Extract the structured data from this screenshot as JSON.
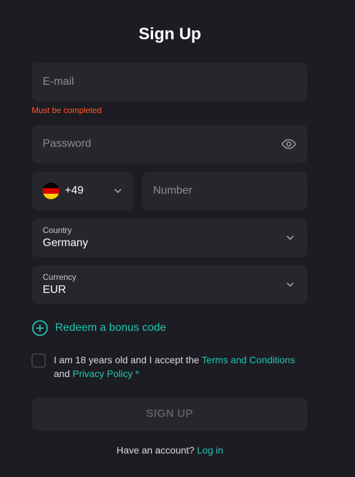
{
  "header": {
    "title": "Sign Up"
  },
  "form": {
    "email": {
      "placeholder": "E-mail",
      "error": "Must be completed"
    },
    "password": {
      "placeholder": "Password",
      "toggle_icon": "eye-icon"
    },
    "phone": {
      "country_code": "+49",
      "flag": "germany-flag-icon",
      "number_placeholder": "Number"
    },
    "country": {
      "label": "Country",
      "value": "Germany"
    },
    "currency": {
      "label": "Currency",
      "value": "EUR"
    },
    "bonus": {
      "label": "Redeem a bonus code",
      "icon": "plus-circle-icon"
    },
    "consent": {
      "prefix": "I am 18 years old and I accept the ",
      "terms_link": "Terms and Conditions",
      "and_text": "and",
      "privacy_link": "Privacy Policy",
      "required_mark": "*"
    },
    "submit_label": "SIGN UP"
  },
  "footer": {
    "question": "Have an account?",
    "login_link": "Log in"
  },
  "colors": {
    "background": "#1c1c22",
    "field": "#26262d",
    "accent": "#1fc7b6",
    "error": "#ff5a2d"
  }
}
